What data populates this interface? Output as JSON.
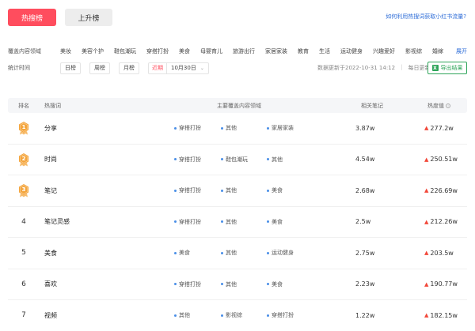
{
  "tabs": {
    "hot": "热搜榜",
    "rising": "上升榜"
  },
  "help_link": "如何利用热搜词获取小红书流量?",
  "filters": {
    "domain_label": "覆盖内容领域",
    "domains": [
      "美妆",
      "美容个护",
      "鞋包潮玩",
      "穿搭打扮",
      "美食",
      "母婴育儿",
      "旅游出行",
      "家居家装",
      "教育",
      "生活",
      "运动健身",
      "兴趣爱好",
      "影视综",
      "婚嫁"
    ],
    "expand": "展开",
    "time_label": "统计时间",
    "time_options": [
      "日榜",
      "周榜",
      "月榜"
    ],
    "recent": "近期",
    "date_value": "10月30日",
    "caret_icon": "chevron-down-icon"
  },
  "update_info": {
    "updated": "数据更新于2022-10-31 14:12",
    "frequency": "每日更新"
  },
  "export": {
    "label": "导出结果",
    "icon": "excel-icon",
    "icon_glyph": "X"
  },
  "table": {
    "headers": {
      "rank": "排名",
      "term": "热搜词",
      "domains": "主要覆盖内容领域",
      "notes": "相关笔记",
      "heat": "热度值"
    },
    "heat_info_icon": "info-icon",
    "flame_icon": "flame-icon",
    "medal_colors": {
      "1": "#f4a53c",
      "2": "#f4a53c",
      "3": "#f4a53c"
    },
    "rows": [
      {
        "rank": "1",
        "term": "分享",
        "tags": [
          "穿搭打扮",
          "其他",
          "家居家装"
        ],
        "notes": "3.87w",
        "heat": "277.2w"
      },
      {
        "rank": "2",
        "term": "时尚",
        "tags": [
          "穿搭打扮",
          "鞋包潮玩",
          "其他"
        ],
        "notes": "4.54w",
        "heat": "250.51w"
      },
      {
        "rank": "3",
        "term": "笔记",
        "tags": [
          "穿搭打扮",
          "其他",
          "美食"
        ],
        "notes": "2.68w",
        "heat": "226.69w"
      },
      {
        "rank": "4",
        "term": "笔记灵感",
        "tags": [
          "穿搭打扮",
          "其他",
          "美食"
        ],
        "notes": "2.5w",
        "heat": "212.26w"
      },
      {
        "rank": "5",
        "term": "美食",
        "tags": [
          "美食",
          "其他",
          "运动健身"
        ],
        "notes": "2.75w",
        "heat": "203.5w"
      },
      {
        "rank": "6",
        "term": "喜欢",
        "tags": [
          "穿搭打扮",
          "其他",
          "美食"
        ],
        "notes": "2.23w",
        "heat": "190.77w"
      },
      {
        "rank": "7",
        "term": "视频",
        "tags": [
          "其他",
          "影视综",
          "穿搭打扮"
        ],
        "notes": "1.22w",
        "heat": "182.15w"
      }
    ]
  }
}
